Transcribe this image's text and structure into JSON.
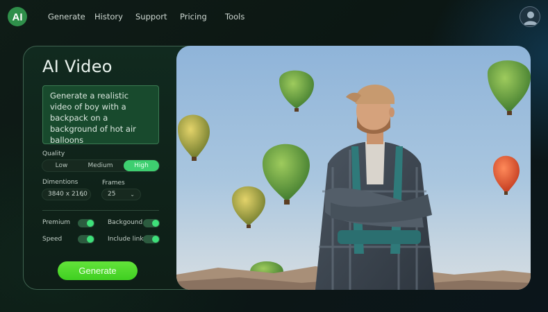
{
  "nav": {
    "items": [
      "Generate",
      "History",
      "Support",
      "Pricing",
      "Tools"
    ]
  },
  "panel": {
    "title": "AI Video",
    "prompt": "Generate a realistic video of boy with a backpack on a background of hot air balloons",
    "quality": {
      "label": "Quality",
      "options": [
        "Low",
        "Medium",
        "High"
      ],
      "selected": "High"
    },
    "dimensions": {
      "label": "Dimentions",
      "value": "3840 x 2160"
    },
    "frames": {
      "label": "Frames",
      "value": "25"
    },
    "toggles": {
      "premium": {
        "label": "Premium",
        "on": true
      },
      "background": {
        "label": "Backgound",
        "on": true
      },
      "speed": {
        "label": "Speed",
        "on": true
      },
      "include_link": {
        "label": "Include link",
        "on": true
      }
    },
    "generate_label": "Generate"
  },
  "colors": {
    "accent": "#3ecf70",
    "button": "#4fd92c",
    "panel_border": "#3f6350"
  },
  "icons": {
    "logo": "ai-logo-icon",
    "avatar": "user-avatar-icon",
    "dropdown": "chevron-down-icon"
  }
}
